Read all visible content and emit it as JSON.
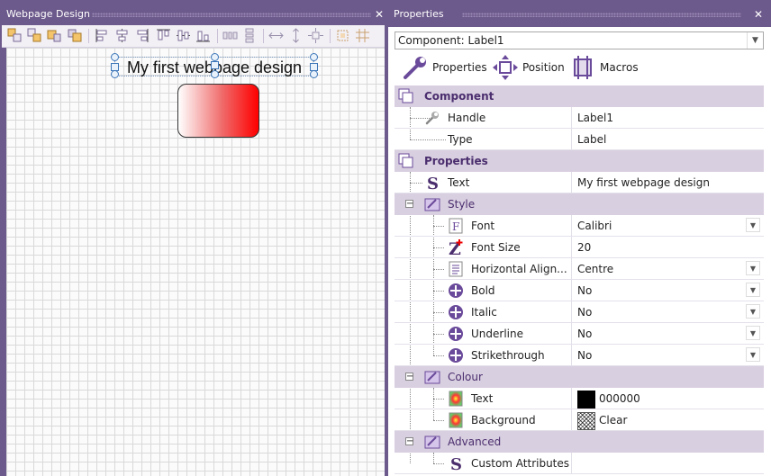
{
  "left_panel": {
    "title": "Webpage Design",
    "close": "✕",
    "design": {
      "label_text": "My first webpage design"
    }
  },
  "right_panel": {
    "title": "Properties",
    "close": "✕",
    "component_select": {
      "value": "Component: Label1"
    },
    "tabs": [
      {
        "label": "Properties",
        "icon": "wrench-icon"
      },
      {
        "label": "Position",
        "icon": "move-icon"
      },
      {
        "label": "Macros",
        "icon": "macros-icon"
      }
    ],
    "sections": {
      "component": "Component",
      "properties": "Properties"
    },
    "groups": {
      "style": "Style",
      "colour": "Colour",
      "advanced": "Advanced"
    },
    "rows": {
      "handle": {
        "name": "Handle",
        "value": "Label1"
      },
      "type": {
        "name": "Type",
        "value": "Label"
      },
      "text": {
        "name": "Text",
        "value": "My first webpage design"
      },
      "font": {
        "name": "Font",
        "value": "Calibri"
      },
      "font_size": {
        "name": "Font Size",
        "value": "20"
      },
      "halign": {
        "name": "Horizontal Align...",
        "value": "Centre"
      },
      "bold": {
        "name": "Bold",
        "value": "No"
      },
      "italic": {
        "name": "Italic",
        "value": "No"
      },
      "underline": {
        "name": "Underline",
        "value": "No"
      },
      "strikethrough": {
        "name": "Strikethrough",
        "value": "No"
      },
      "colour_text": {
        "name": "Text",
        "value": "000000"
      },
      "background": {
        "name": "Background",
        "value": "Clear"
      },
      "custom_attributes": {
        "name": "Custom Attributes",
        "value": ""
      }
    },
    "colors": {
      "accent": "#6d5a8c",
      "section_bg": "#d8cfe0",
      "text_colour_swatch": "#000000"
    }
  }
}
